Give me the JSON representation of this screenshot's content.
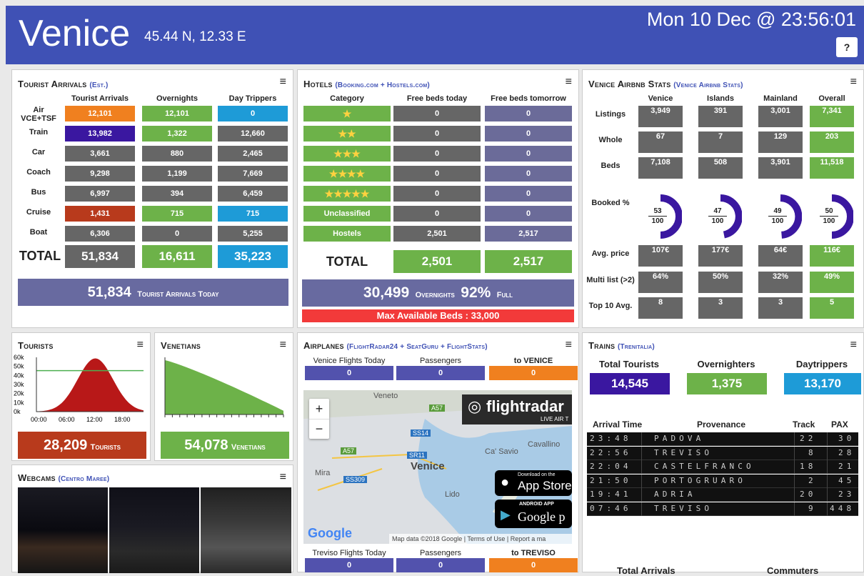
{
  "header": {
    "city": "Venice",
    "coords": "45.44 N, 12.33 E",
    "clock": "Mon 10 Dec @ 23:56:01",
    "help_icon": "?"
  },
  "tourist_arrivals": {
    "title": "Tourist Arrivals",
    "subtitle": "(Est.)",
    "columns": [
      "Tourist Arrivals",
      "Overnights",
      "Day Trippers"
    ],
    "rows": [
      {
        "label": "Air VCE+TSF",
        "values": [
          "12,101",
          "12,101",
          "0"
        ]
      },
      {
        "label": "Train",
        "values": [
          "13,982",
          "1,322",
          "12,660"
        ]
      },
      {
        "label": "Car",
        "values": [
          "3,661",
          "880",
          "2,465"
        ]
      },
      {
        "label": "Coach",
        "values": [
          "9,298",
          "1,199",
          "7,669"
        ]
      },
      {
        "label": "Bus",
        "values": [
          "6,997",
          "394",
          "6,459"
        ]
      },
      {
        "label": "Cruise",
        "values": [
          "1,431",
          "715",
          "715"
        ]
      },
      {
        "label": "Boat",
        "values": [
          "6,306",
          "0",
          "5,255"
        ]
      }
    ],
    "total_label": "TOTAL",
    "totals": [
      "51,834",
      "16,611",
      "35,223"
    ],
    "summary_value": "51,834",
    "summary_label": "Tourist Arrivals Today"
  },
  "hotels": {
    "title": "Hotels",
    "subtitle": "(Booking.com + Hostels.com)",
    "columns": [
      "Category",
      "Free beds today",
      "Free beds tomorrow"
    ],
    "rows": [
      {
        "label": "★",
        "values": [
          "0",
          "0"
        ]
      },
      {
        "label": "★★",
        "values": [
          "0",
          "0"
        ]
      },
      {
        "label": "★★★",
        "values": [
          "0",
          "0"
        ]
      },
      {
        "label": "★★★★",
        "values": [
          "0",
          "0"
        ]
      },
      {
        "label": "★★★★★",
        "values": [
          "0",
          "0"
        ]
      },
      {
        "label": "Unclassified",
        "values": [
          "0",
          "0"
        ]
      },
      {
        "label": "Hostels",
        "values": [
          "2,501",
          "2,517"
        ]
      }
    ],
    "total_label": "TOTAL",
    "totals": [
      "2,501",
      "2,517"
    ],
    "overnights_value": "30,499",
    "overnights_label": "Overnights",
    "full_value": "92%",
    "full_label": "Full",
    "max_beds": "Max Available Beds : 33,000"
  },
  "airbnb": {
    "title": "Venice Airbnb Stats",
    "subtitle": "(Venice Airbnb Stats)",
    "columns": [
      "Venice",
      "Islands",
      "Mainland",
      "Overall"
    ],
    "listings": {
      "label": "Listings",
      "values": [
        "3,949",
        "391",
        "3,001",
        "7,341"
      ]
    },
    "whole": {
      "label": "Whole",
      "values": [
        "67",
        "7",
        "129",
        "203"
      ]
    },
    "beds": {
      "label": "Beds",
      "values": [
        "7,108",
        "508",
        "3,901",
        "11,518"
      ]
    },
    "booked": {
      "label": "Booked %",
      "values": [
        53,
        47,
        49,
        50
      ],
      "denom": "100",
      "texts": [
        "53",
        "47",
        "49",
        "50"
      ]
    },
    "price": {
      "label": "Avg. price",
      "values": [
        "107€",
        "177€",
        "64€",
        "116€"
      ]
    },
    "multi": {
      "label": "Multi list (>2)",
      "values": [
        "64%",
        "50%",
        "32%",
        "49%"
      ]
    },
    "top10": {
      "label": "Top 10 Avg.",
      "values": [
        "8",
        "3",
        "3",
        "5"
      ]
    }
  },
  "tourists_chart": {
    "title": "Tourists",
    "y_ticks": [
      "60k",
      "50k",
      "40k",
      "30k",
      "20k",
      "10k",
      "0k"
    ],
    "x_ticks": [
      "00:00",
      "06:00",
      "12:00",
      "18:00"
    ],
    "total_value": "28,209",
    "total_label": "Tourists"
  },
  "venetians_chart": {
    "title": "Venetians",
    "total_value": "54,078",
    "total_label": "Venetians"
  },
  "chart_data": [
    {
      "type": "area",
      "title": "Tourists",
      "x": [
        "00:00",
        "06:00",
        "12:00",
        "18:00"
      ],
      "ylim": [
        0,
        60000
      ],
      "series": [
        {
          "values": [
            3000,
            25000,
            60000,
            20000
          ]
        }
      ]
    },
    {
      "type": "area",
      "title": "Venetians",
      "series": [
        {
          "values": [
            54078,
            50000,
            45000,
            38000,
            30000,
            22000,
            12000,
            2000
          ]
        }
      ]
    }
  ],
  "webcams": {
    "title": "Webcams",
    "subtitle": "(Centro Maree)"
  },
  "airplanes": {
    "title": "Airplanes",
    "subtitle": "(FlightRadar24 + SeatGuru + FlightStats)",
    "top": {
      "labels": [
        "Venice Flights Today",
        "Passengers",
        "to VENICE"
      ],
      "values": [
        "0",
        "0",
        "0"
      ]
    },
    "bottom": {
      "labels": [
        "Treviso Flights Today",
        "Passengers",
        "to TREVISO"
      ],
      "values": [
        "0",
        "0",
        "0"
      ]
    },
    "map": {
      "zoom_in": "+",
      "zoom_out": "−",
      "places": [
        "Veneto",
        "A57",
        "SS14",
        "A57",
        "SR11",
        "Cavallino",
        "Ca' Savio",
        "Venice",
        "Mira",
        "SS309",
        "Lido"
      ],
      "brand": "flightradar",
      "brand_sub": "LIVE AIR T",
      "app_store": "App Store",
      "app_store_small": "Download on the",
      "google_play": "Google p",
      "google_play_small": "ANDROID APP",
      "google": "Google",
      "attribution": "Map data ©2018 Google",
      "terms": "Terms of Use",
      "report": "Report a ma"
    }
  },
  "trains": {
    "title": "Trains",
    "subtitle": "(Trenitalia)",
    "stats": [
      {
        "label": "Total Tourists",
        "value": "14,545"
      },
      {
        "label": "Overnighters",
        "value": "1,375"
      },
      {
        "label": "Daytrippers",
        "value": "13,170"
      }
    ],
    "table_headers": [
      "Arrival Time",
      "Provenance",
      "Track",
      "PAX"
    ],
    "rows": [
      {
        "time": "23:48",
        "from": "PADOVA",
        "track": "22",
        "pax": "30"
      },
      {
        "time": "22:56",
        "from": "TREVISO",
        "track": "8",
        "pax": "28"
      },
      {
        "time": "22:04",
        "from": "CASTELFRANCO",
        "track": "18",
        "pax": "21"
      },
      {
        "time": "21:50",
        "from": "PORTOGRUARO",
        "track": "2",
        "pax": "45"
      },
      {
        "time": "19:41",
        "from": "ADRIA",
        "track": "20",
        "pax": "23"
      },
      {
        "time": "07:46",
        "from": "TREVISO",
        "track": "9",
        "pax": "448"
      }
    ],
    "footer": [
      "Total Arrivals",
      "Commuters"
    ]
  },
  "colors": {
    "header": "#3f51b5",
    "gray": "#666666",
    "green": "#6db249",
    "blue": "#1e9bd7",
    "orange": "#f0801f",
    "purple": "#3a17a0",
    "red": "#b83a1c"
  },
  "menu_icon": "≡"
}
